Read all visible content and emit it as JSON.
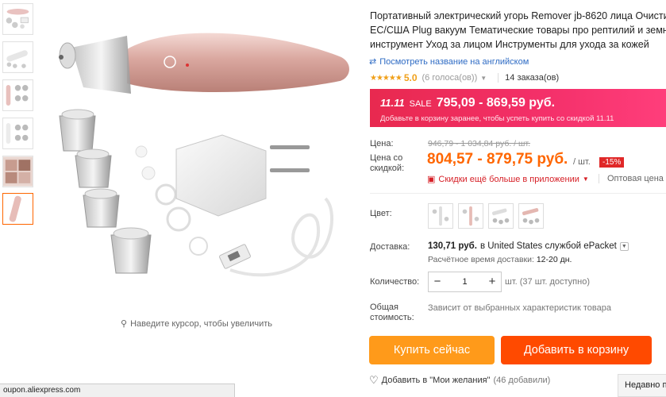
{
  "product": {
    "title_lines": [
      "Портативный электрический угорь Remover jb-8620 лица Очиститель пор",
      "ЕС/США Plug вакуум Тематические товары про рептилий и земноводных",
      "инструмент Уход за лицом Инструменты для ухода за кожей"
    ],
    "translate_link": "Посмотреть название на английском",
    "rating_value": "5.0",
    "votes": "(6 голоса(ов))",
    "orders": "14 заказа(ов)"
  },
  "sale": {
    "badge": "11.11",
    "tag": "SALE",
    "price_range": "795,09 - 869,59 руб.",
    "subtitle": "Добавьте в корзину заранее, чтобы успеть купить со скидкой 11.11"
  },
  "pricing": {
    "price_label": "Цена:",
    "old_price": "946,79 - 1 034,84 руб. / шт.",
    "discount_label_1": "Цена со",
    "discount_label_2": "скидкой:",
    "discount_price": "804,57 - 879,75 руб.",
    "unit": "/ шт.",
    "discount_badge": "-15%",
    "app_promo": "Скидки ещё больше в приложении",
    "wholesale": "Оптовая цена"
  },
  "options": {
    "color_label": "Цвет:",
    "swatch_count_note": "4 color swatches"
  },
  "shipping": {
    "label": "Доставка:",
    "cost": "130,71 руб.",
    "to": "в United States службой ePacket",
    "time_label": "Расчётное время доставки:",
    "time_value": "12-20 дн."
  },
  "quantity": {
    "label": "Количество:",
    "minus": "−",
    "value": "1",
    "plus": "+",
    "available": "шт. (37 шт. доступно)"
  },
  "total": {
    "label_1": "Общая",
    "label_2": "стоимость:",
    "note": "Зависит от выбранных характеристик товара"
  },
  "actions": {
    "buy_now": "Купить сейчас",
    "add_to_cart": "Добавить в корзину",
    "wishlist": "Добавить в \"Мои желания\"",
    "wishlist_count": "(46 добавили)"
  },
  "gallery": {
    "zoom_hint": "Наведите курсор, чтобы увеличить"
  },
  "status_bar": {
    "url": "oupon.aliexpress.com"
  },
  "recent_tab": "Недавно п",
  "colors": {
    "accent_orange": "#ff4a00",
    "buy_orange": "#ff9a1a",
    "sale_pink": "#f4306a",
    "rating_gold": "#f0a01a",
    "link_blue": "#2e6bc4"
  }
}
